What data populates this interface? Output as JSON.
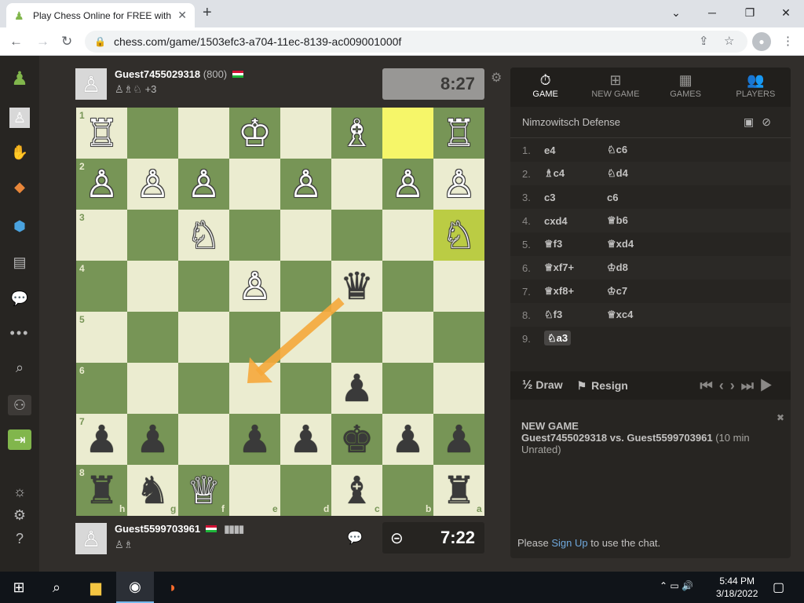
{
  "browser": {
    "tab_title": "Play Chess Online for FREE with Friends",
    "tab_close": "✕",
    "new_tab": "+",
    "url": "chess.com/game/1503efc3-a704-11ec-8139-ac009001000f",
    "window_controls": [
      "⌄",
      "─",
      "❐",
      "✕"
    ]
  },
  "top_player": {
    "name": "Guest7455029318",
    "rating": "(800)",
    "captured": "♙♗♘ +3",
    "clock": "8:27",
    "clock_bg": "#989795"
  },
  "bottom_player": {
    "name": "Guest5599703961",
    "captured": "♙♗",
    "clock": "7:22",
    "clock_bg": "#262421"
  },
  "board": {
    "light": "#ebecd0",
    "dark": "#779556",
    "rank_labels": [
      "1",
      "2",
      "3",
      "4",
      "5",
      "6",
      "7",
      "8"
    ],
    "file_labels": [
      "h",
      "g",
      "f",
      "e",
      "d",
      "c",
      "b",
      "a"
    ],
    "pieces_desc_row_major_from_top": [
      [
        "♖",
        "",
        "",
        "♔",
        "",
        "♗",
        "",
        "♖"
      ],
      [
        "♙",
        "♙",
        "♙",
        "",
        "♙",
        "",
        "♙",
        "♙"
      ],
      [
        "",
        "",
        "♘",
        "",
        "",
        "",
        "",
        "♘"
      ],
      [
        "",
        "",
        "",
        "♙",
        "",
        "♛",
        "",
        ""
      ],
      [
        "",
        "",
        "",
        "",
        "",
        "",
        "",
        ""
      ],
      [
        "",
        "",
        "",
        "",
        "",
        "♟",
        "",
        ""
      ],
      [
        "♟",
        "♟",
        "",
        "♟",
        "♟",
        "♚",
        "♟",
        "♟"
      ],
      [
        "♜",
        "♞",
        "♕",
        "",
        "",
        "♝",
        "",
        "♜"
      ]
    ]
  },
  "panel": {
    "tabs": [
      {
        "icon": "⏱",
        "label": "GAME"
      },
      {
        "icon": "⊞",
        "label": "NEW GAME"
      },
      {
        "icon": "▦",
        "label": "GAMES"
      },
      {
        "icon": "👥",
        "label": "PLAYERS"
      }
    ],
    "opening": "Nimzowitsch Defense",
    "moves": [
      {
        "n": "1.",
        "w": "e4",
        "b": "♘c6"
      },
      {
        "n": "2.",
        "w": "♗c4",
        "b": "♘d4"
      },
      {
        "n": "3.",
        "w": "c3",
        "b": "c6"
      },
      {
        "n": "4.",
        "w": "cxd4",
        "b": "♕b6"
      },
      {
        "n": "5.",
        "w": "♕f3",
        "b": "♕xd4"
      },
      {
        "n": "6.",
        "w": "♕xf7+",
        "b": "♔d8"
      },
      {
        "n": "7.",
        "w": "♕xf8+",
        "b": "♔c7"
      },
      {
        "n": "8.",
        "w": "♘f3",
        "b": "♕xc4"
      },
      {
        "n": "9.",
        "w": "♘a3",
        "b": ""
      }
    ],
    "draw_label": "Draw",
    "draw_icon": "½",
    "resign_label": "Resign",
    "chat_title": "NEW GAME",
    "chat_players": "Guest7455029318 vs. Guest5599703961",
    "chat_format": "(10 min Unrated)",
    "please": "Please",
    "signup": "Sign Up",
    "chat_tail": "to use the chat."
  },
  "taskbar": {
    "time": "5:44 PM",
    "date": "3/18/2022"
  }
}
